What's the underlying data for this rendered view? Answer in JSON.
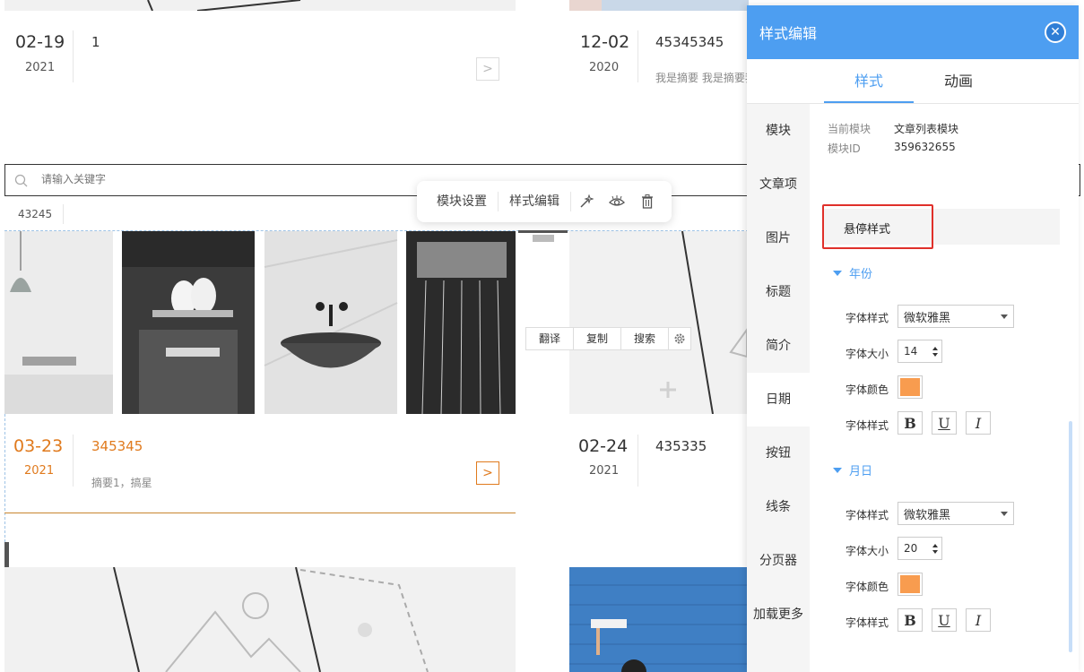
{
  "colors": {
    "accent": "#4d9ef1",
    "hover": "#e07a1d",
    "swatch_year": "#f89c4f",
    "swatch_day": "#f89c4f",
    "red_outline": "#e0302a"
  },
  "articles": [
    {
      "day": "02-19",
      "year": "2021",
      "title": "1",
      "summary": ""
    },
    {
      "day": "12-02",
      "year": "2020",
      "title": "45345345",
      "summary": "我是摘要 我是摘要我"
    },
    {
      "day": "03-23",
      "year": "2021",
      "title": "345345",
      "summary": "摘要1，搞星"
    },
    {
      "day": "02-24",
      "year": "2021",
      "title": "435335",
      "summary": ""
    }
  ],
  "arrow_glyph": ">",
  "search": {
    "placeholder": "请输入关键字",
    "icon": "search-icon"
  },
  "tag_row": {
    "tag": "43245"
  },
  "toolbar": {
    "module_settings": "模块设置",
    "style_edit": "样式编辑",
    "icons": [
      "magic-wand-icon",
      "eye-icon",
      "trash-icon"
    ]
  },
  "image_bar": {
    "translate": "翻译",
    "copy": "复制",
    "search": "搜索",
    "icon": "gear-icon"
  },
  "panel": {
    "title": "样式编辑",
    "close": "✕",
    "tabs": [
      "样式",
      "动画"
    ],
    "nav": [
      "模块",
      "文章项",
      "图片",
      "标题",
      "简介",
      "日期",
      "按钮",
      "线条",
      "分页器",
      "加载更多"
    ],
    "meta": {
      "module_label": "当前模块",
      "module_value": "文章列表模块",
      "id_label": "模块ID",
      "id_value": "359632655"
    },
    "hover_style": "悬停样式",
    "year_section": {
      "title": "年份",
      "font_style_label": "字体样式",
      "font_style_value": "微软雅黑",
      "font_size_label": "字体大小",
      "font_size_value": "14",
      "font_color_label": "字体颜色",
      "format_label": "字体样式"
    },
    "day_section": {
      "title": "月日",
      "font_style_label": "字体样式",
      "font_style_value": "微软雅黑",
      "font_size_label": "字体大小",
      "font_size_value": "20",
      "font_color_label": "字体颜色",
      "format_label": "字体样式"
    },
    "format_buttons": [
      "B",
      "U",
      "I"
    ]
  }
}
